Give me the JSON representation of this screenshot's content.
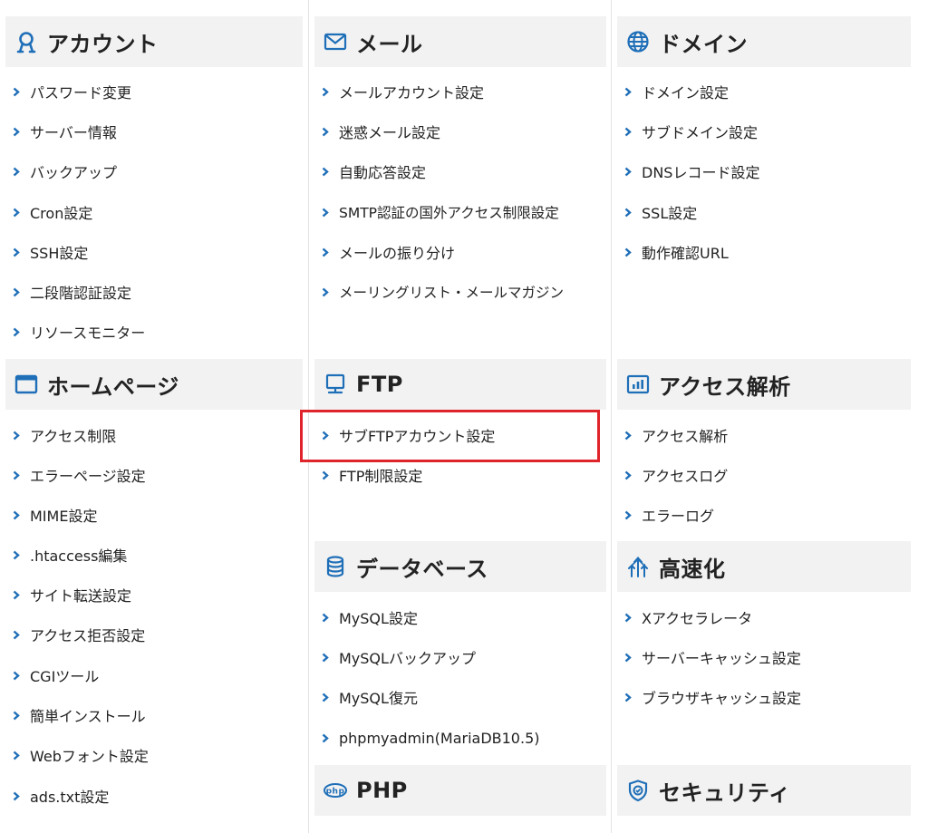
{
  "colors": {
    "icon_blue": "#1f6fb8",
    "arrow_blue": "#1f6fb8",
    "highlight_red": "#e0242c",
    "header_bg": "#f2f2f2"
  },
  "account": {
    "title": "アカウント",
    "icon": "user-icon",
    "items": [
      "パスワード変更",
      "サーバー情報",
      "バックアップ",
      "Cron設定",
      "SSH設定",
      "二段階認証設定",
      "リソースモニター"
    ]
  },
  "mail": {
    "title": "メール",
    "icon": "envelope-icon",
    "items": [
      "メールアカウント設定",
      "迷惑メール設定",
      "自動応答設定",
      "SMTP認証の国外アクセス制限設定",
      "メールの振り分け",
      "メーリングリスト・メールマガジン"
    ]
  },
  "domain": {
    "title": "ドメイン",
    "icon": "globe-icon",
    "items": [
      "ドメイン設定",
      "サブドメイン設定",
      "DNSレコード設定",
      "SSL設定",
      "動作確認URL"
    ]
  },
  "homepage": {
    "title": "ホームページ",
    "icon": "browser-window-icon",
    "items": [
      "アクセス制限",
      "エラーページ設定",
      "MIME設定",
      ".htaccess編集",
      "サイト転送設定",
      "アクセス拒否設定",
      "CGIツール",
      "簡単インストール",
      "Webフォント設定",
      "ads.txt設定"
    ]
  },
  "ftp": {
    "title": "FTP",
    "icon": "monitor-icon",
    "items": [
      "サブFTPアカウント設定",
      "FTP制限設定"
    ]
  },
  "access": {
    "title": "アクセス解析",
    "icon": "bar-chart-icon",
    "items": [
      "アクセス解析",
      "アクセスログ",
      "エラーログ"
    ]
  },
  "database": {
    "title": "データベース",
    "icon": "database-icon",
    "items": [
      "MySQL設定",
      "MySQLバックアップ",
      "MySQL復元",
      "phpmyadmin(MariaDB10.5)"
    ]
  },
  "speed": {
    "title": "高速化",
    "icon": "speed-arrows-icon",
    "items": [
      "Xアクセラレータ",
      "サーバーキャッシュ設定",
      "ブラウザキャッシュ設定"
    ]
  },
  "php": {
    "title": "PHP",
    "icon": "php-icon"
  },
  "security": {
    "title": "セキュリティ",
    "icon": "shield-icon"
  }
}
